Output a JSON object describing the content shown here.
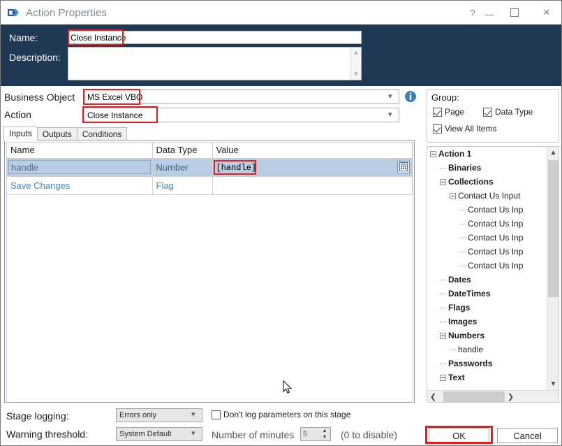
{
  "window": {
    "title": "Action Properties",
    "icon": "action-stage-icon",
    "controls": {
      "help": "?",
      "minimize": "—",
      "maximize": "□",
      "close": "×"
    }
  },
  "header": {
    "name_label": "Name:",
    "name_value": "Close Instance",
    "description_label": "Description:",
    "description_value": ""
  },
  "selectors": {
    "business_object_label": "Business Object",
    "business_object_value": "MS Excel VBO",
    "action_label": "Action",
    "action_value": "Close Instance",
    "info_icon": "info-icon"
  },
  "tabs": [
    {
      "label": "Inputs",
      "active": true
    },
    {
      "label": "Outputs",
      "active": false
    },
    {
      "label": "Conditions",
      "active": false
    }
  ],
  "parameters": {
    "columns": [
      "Name",
      "Data Type",
      "Value"
    ],
    "rows": [
      {
        "name": "handle",
        "data_type": "Number",
        "value": "[handle]",
        "selected": true,
        "has_expression_button": true
      },
      {
        "name": "Save Changes",
        "data_type": "Flag",
        "value": "",
        "selected": false,
        "has_expression_button": false
      }
    ]
  },
  "group_panel": {
    "title": "Group:",
    "checkboxes": [
      {
        "label": "Page",
        "checked": true
      },
      {
        "label": "Data Type",
        "checked": true
      },
      {
        "label": "View All Items",
        "checked": true
      }
    ]
  },
  "tree": {
    "nodes": [
      {
        "label": "Action 1",
        "depth": 0,
        "type": "expander",
        "bold": true
      },
      {
        "label": "Binaries",
        "depth": 1,
        "type": "leaf",
        "bold": true
      },
      {
        "label": "Collections",
        "depth": 1,
        "type": "expander",
        "bold": true
      },
      {
        "label": "Contact Us Input",
        "depth": 2,
        "type": "expander",
        "bold": false
      },
      {
        "label": "Contact Us Inp",
        "depth": 3,
        "type": "leaf",
        "bold": false
      },
      {
        "label": "Contact Us Inp",
        "depth": 3,
        "type": "leaf",
        "bold": false
      },
      {
        "label": "Contact Us Inp",
        "depth": 3,
        "type": "leaf",
        "bold": false
      },
      {
        "label": "Contact Us Inp",
        "depth": 3,
        "type": "leaf",
        "bold": false
      },
      {
        "label": "Contact Us Inp",
        "depth": 3,
        "type": "leaf",
        "bold": false
      },
      {
        "label": "Dates",
        "depth": 1,
        "type": "leaf",
        "bold": true
      },
      {
        "label": "DateTimes",
        "depth": 1,
        "type": "leaf",
        "bold": true
      },
      {
        "label": "Flags",
        "depth": 1,
        "type": "leaf",
        "bold": true
      },
      {
        "label": "Images",
        "depth": 1,
        "type": "leaf",
        "bold": true
      },
      {
        "label": "Numbers",
        "depth": 1,
        "type": "expander",
        "bold": true
      },
      {
        "label": "handle",
        "depth": 2,
        "type": "leaf",
        "bold": false
      },
      {
        "label": "Passwords",
        "depth": 1,
        "type": "leaf",
        "bold": true
      },
      {
        "label": "Text",
        "depth": 1,
        "type": "expander",
        "bold": true
      }
    ]
  },
  "footer": {
    "stage_logging_label": "Stage logging:",
    "stage_logging_value": "Errors only",
    "dont_log_label": "Don't log parameters on this stage",
    "dont_log_checked": false,
    "warning_threshold_label": "Warning threshold:",
    "warning_threshold_value": "System Default",
    "minutes_label": "Number of minutes",
    "minutes_value": "5",
    "disable_hint": "(0 to disable)",
    "ok_label": "OK",
    "cancel_label": "Cancel"
  },
  "colors": {
    "header_navy": "#1f3954",
    "highlight_red": "#e02020",
    "row_selected": "#b9cde5",
    "link_blue": "#3a87c8",
    "info_blue": "#3d7ebc"
  }
}
